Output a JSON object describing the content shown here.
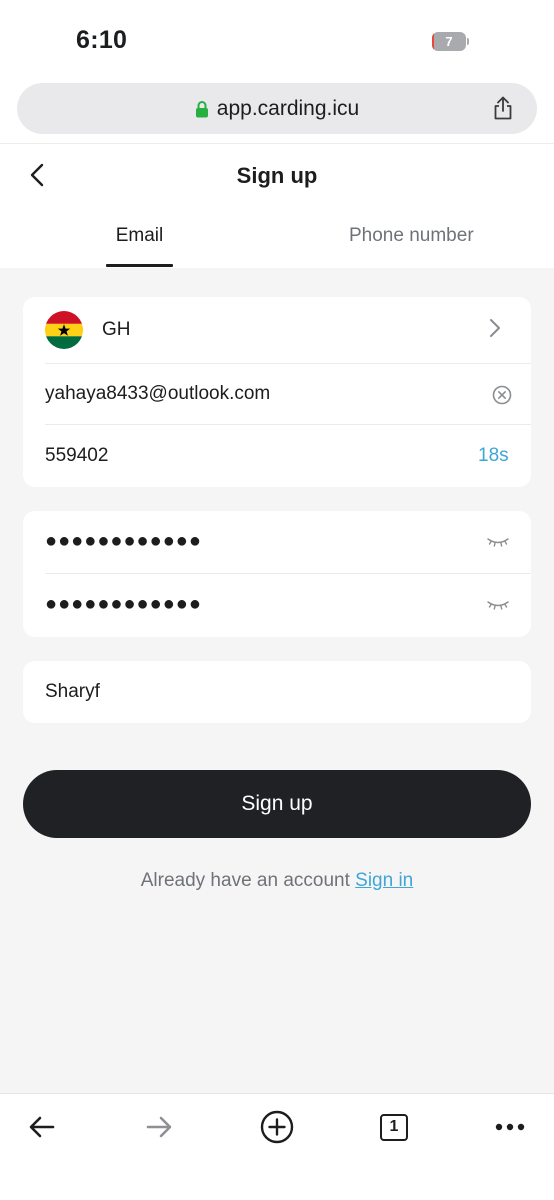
{
  "status_bar": {
    "time": "6:10",
    "battery_level": "7",
    "battery_fraction": 0.07,
    "battery_color": "#e8473c"
  },
  "browser": {
    "url": "app.carding.icu",
    "lock_icon": "lock-icon",
    "share_icon": "share-icon"
  },
  "header": {
    "title": "Sign up",
    "back_icon": "chevron-left-icon"
  },
  "tabs": [
    {
      "label": "Email",
      "active": true
    },
    {
      "label": "Phone number",
      "active": false
    }
  ],
  "form": {
    "country": {
      "code": "GH",
      "flag_icon": "ghana-flag-icon"
    },
    "email": "yahaya8433@outlook.com",
    "verification_code": "559402",
    "resend_countdown": "18s",
    "password": "●●●●●●●●●●●●",
    "confirm_password": "●●●●●●●●●●●●",
    "name": "Sharyf"
  },
  "actions": {
    "submit_label": "Sign up",
    "signin_prompt": "Already have an account",
    "signin_link": "Sign in"
  },
  "bottom_bar": {
    "icons": [
      "back-arrow-icon",
      "forward-arrow-icon",
      "new-tab-plus-icon",
      "tab-count-icon",
      "more-icon"
    ],
    "tab_count": "1"
  },
  "colors": {
    "accent": "#3fa6d6",
    "button": "#202124",
    "background": "#f5f5f5"
  }
}
